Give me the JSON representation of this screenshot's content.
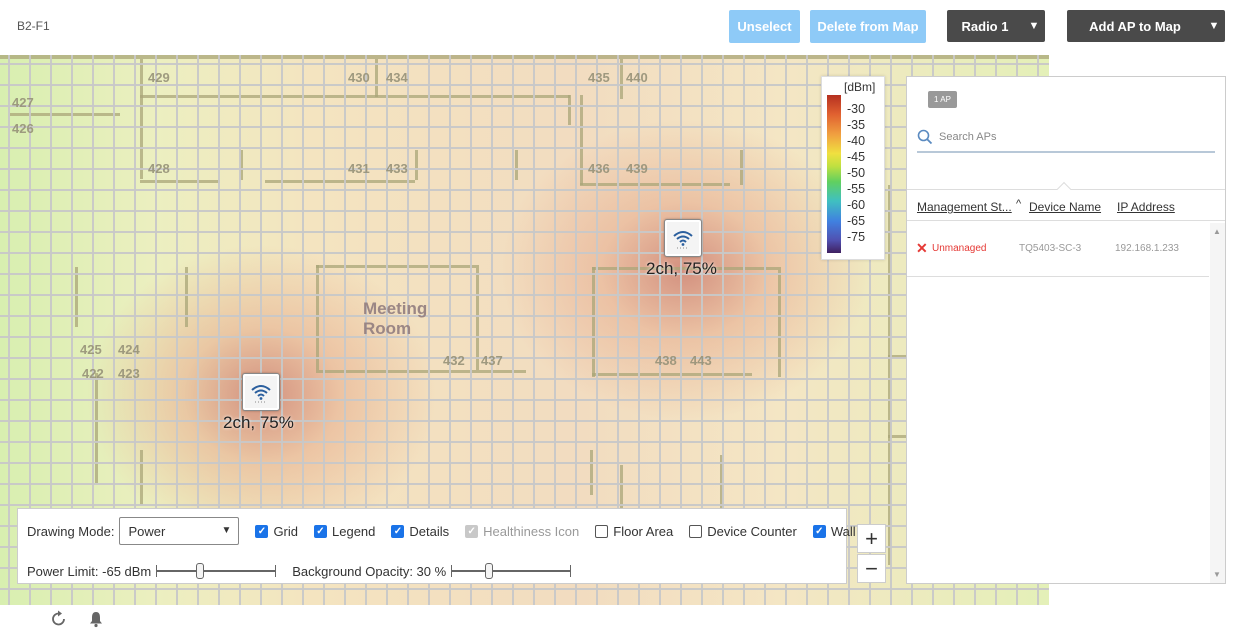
{
  "header": {
    "floor": "B2-F1",
    "unselect_label": "Unselect",
    "delete_label": "Delete from Map",
    "radio_label": "Radio 1",
    "add_ap_label": "Add AP to Map"
  },
  "map": {
    "rooms": [
      "429",
      "430",
      "434",
      "435",
      "440",
      "427",
      "426",
      "428",
      "431",
      "433",
      "436",
      "439",
      "425",
      "424",
      "422",
      "423",
      "432",
      "437",
      "438",
      "443"
    ],
    "meeting_room": [
      "Meeting",
      "Room"
    ],
    "aps": [
      {
        "label": "2ch, 75%"
      },
      {
        "label": "2ch, 75%"
      }
    ]
  },
  "legend": {
    "unit": "[dBm]",
    "ticks": [
      "-30",
      "-35",
      "-40",
      "-45",
      "-50",
      "-55",
      "-60",
      "-65",
      "-75"
    ]
  },
  "controls": {
    "drawing_mode_label": "Drawing Mode:",
    "drawing_mode_value": "Power",
    "checkboxes": [
      {
        "label": "Grid",
        "checked": true
      },
      {
        "label": "Legend",
        "checked": true
      },
      {
        "label": "Details",
        "checked": true
      },
      {
        "label": "Healthiness Icon",
        "checked": true,
        "disabled": true
      },
      {
        "label": "Floor Area",
        "checked": false
      },
      {
        "label": "Device Counter",
        "checked": false
      },
      {
        "label": "Wall",
        "checked": true
      }
    ],
    "power_limit_label": "Power Limit: -65 dBm",
    "power_limit_fraction": 0.36,
    "bg_opacity_label": "Background Opacity: 30 %",
    "bg_opacity_fraction": 0.3
  },
  "zoom": {
    "in": "+",
    "out": "−"
  },
  "panel": {
    "count_badge": "1 AP",
    "search_placeholder": "Search APs",
    "columns": {
      "management": "Management St...",
      "sort_indicator": "^",
      "device_name": "Device Name",
      "ip_address": "IP Address"
    },
    "rows": [
      {
        "status": "Unmanaged",
        "device": "TQ5403-SC-3",
        "ip": "192.168.1.233"
      }
    ]
  },
  "colors": {
    "primary_light": "#8ecaf7",
    "dark_button": "#4a4a4a",
    "checkbox": "#1a73e8",
    "error": "#e53935"
  }
}
